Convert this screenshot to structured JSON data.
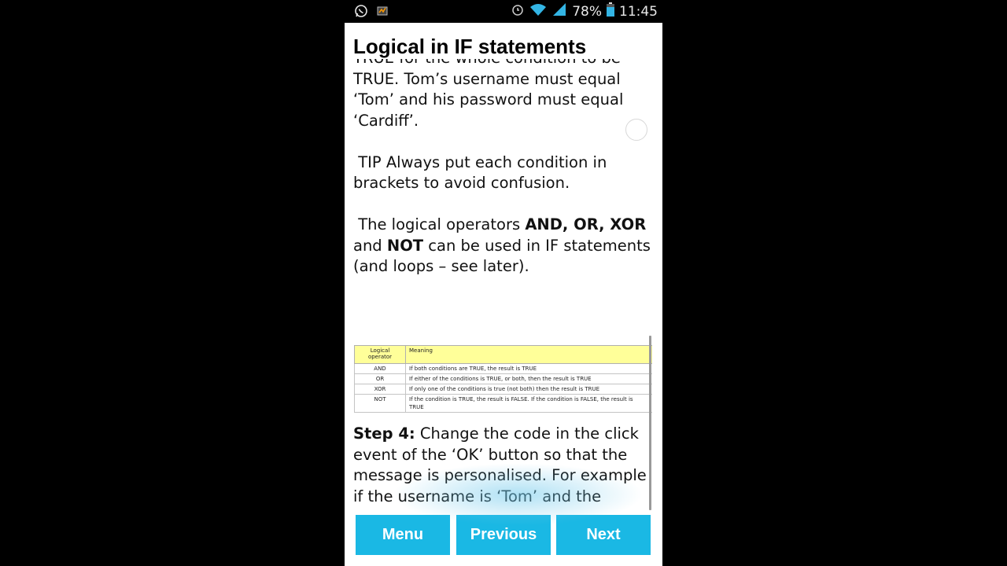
{
  "status_bar": {
    "battery": "78%",
    "time": "11:45",
    "icons": [
      "whatsapp-icon",
      "app-notification-icon",
      "alarm-icon",
      "wifi-icon",
      "signal-icon",
      "battery-icon"
    ]
  },
  "page": {
    "title": "Logical in IF statements",
    "cut_line": "TRUE for the whole condition to be",
    "para1": "TRUE. Tom’s username must equal ‘Tom’ and his password must equal ‘Cardiff’.",
    "tip": " TIP Always put each condition in brackets to avoid confusion.",
    "ops_intro_a": " The logical operators ",
    "ops_intro_bold1": "AND, OR, XOR",
    "ops_intro_b": " and ",
    "ops_intro_bold2": "NOT",
    "ops_intro_c": " can be used in IF statements (and loops – see later)."
  },
  "table": {
    "headers": [
      "Logical operator",
      "Meaning"
    ],
    "rows": [
      [
        "AND",
        "If both conditions are TRUE, the result is TRUE"
      ],
      [
        "OR",
        "If either of the conditions is TRUE, or both, then the result is TRUE"
      ],
      [
        "XOR",
        "If only one of the conditions is true (not both) then the result is TRUE"
      ],
      [
        "NOT",
        "If the condition is TRUE, the result is FALSE. If the condition is FALSE, the result is TRUE"
      ]
    ]
  },
  "step": {
    "label": "Step 4:",
    "text": " Change the code in the click event of the ‘OK’ button so that the message is personalised. For example if the username is ‘Tom’ and the password is correct, the message “Welcome Tom” should be output."
  },
  "buttons": {
    "menu": "Menu",
    "previous": "Previous",
    "next": "Next"
  },
  "colors": {
    "button_bg": "#1ab8e4",
    "table_header_bg": "#ffff99"
  }
}
